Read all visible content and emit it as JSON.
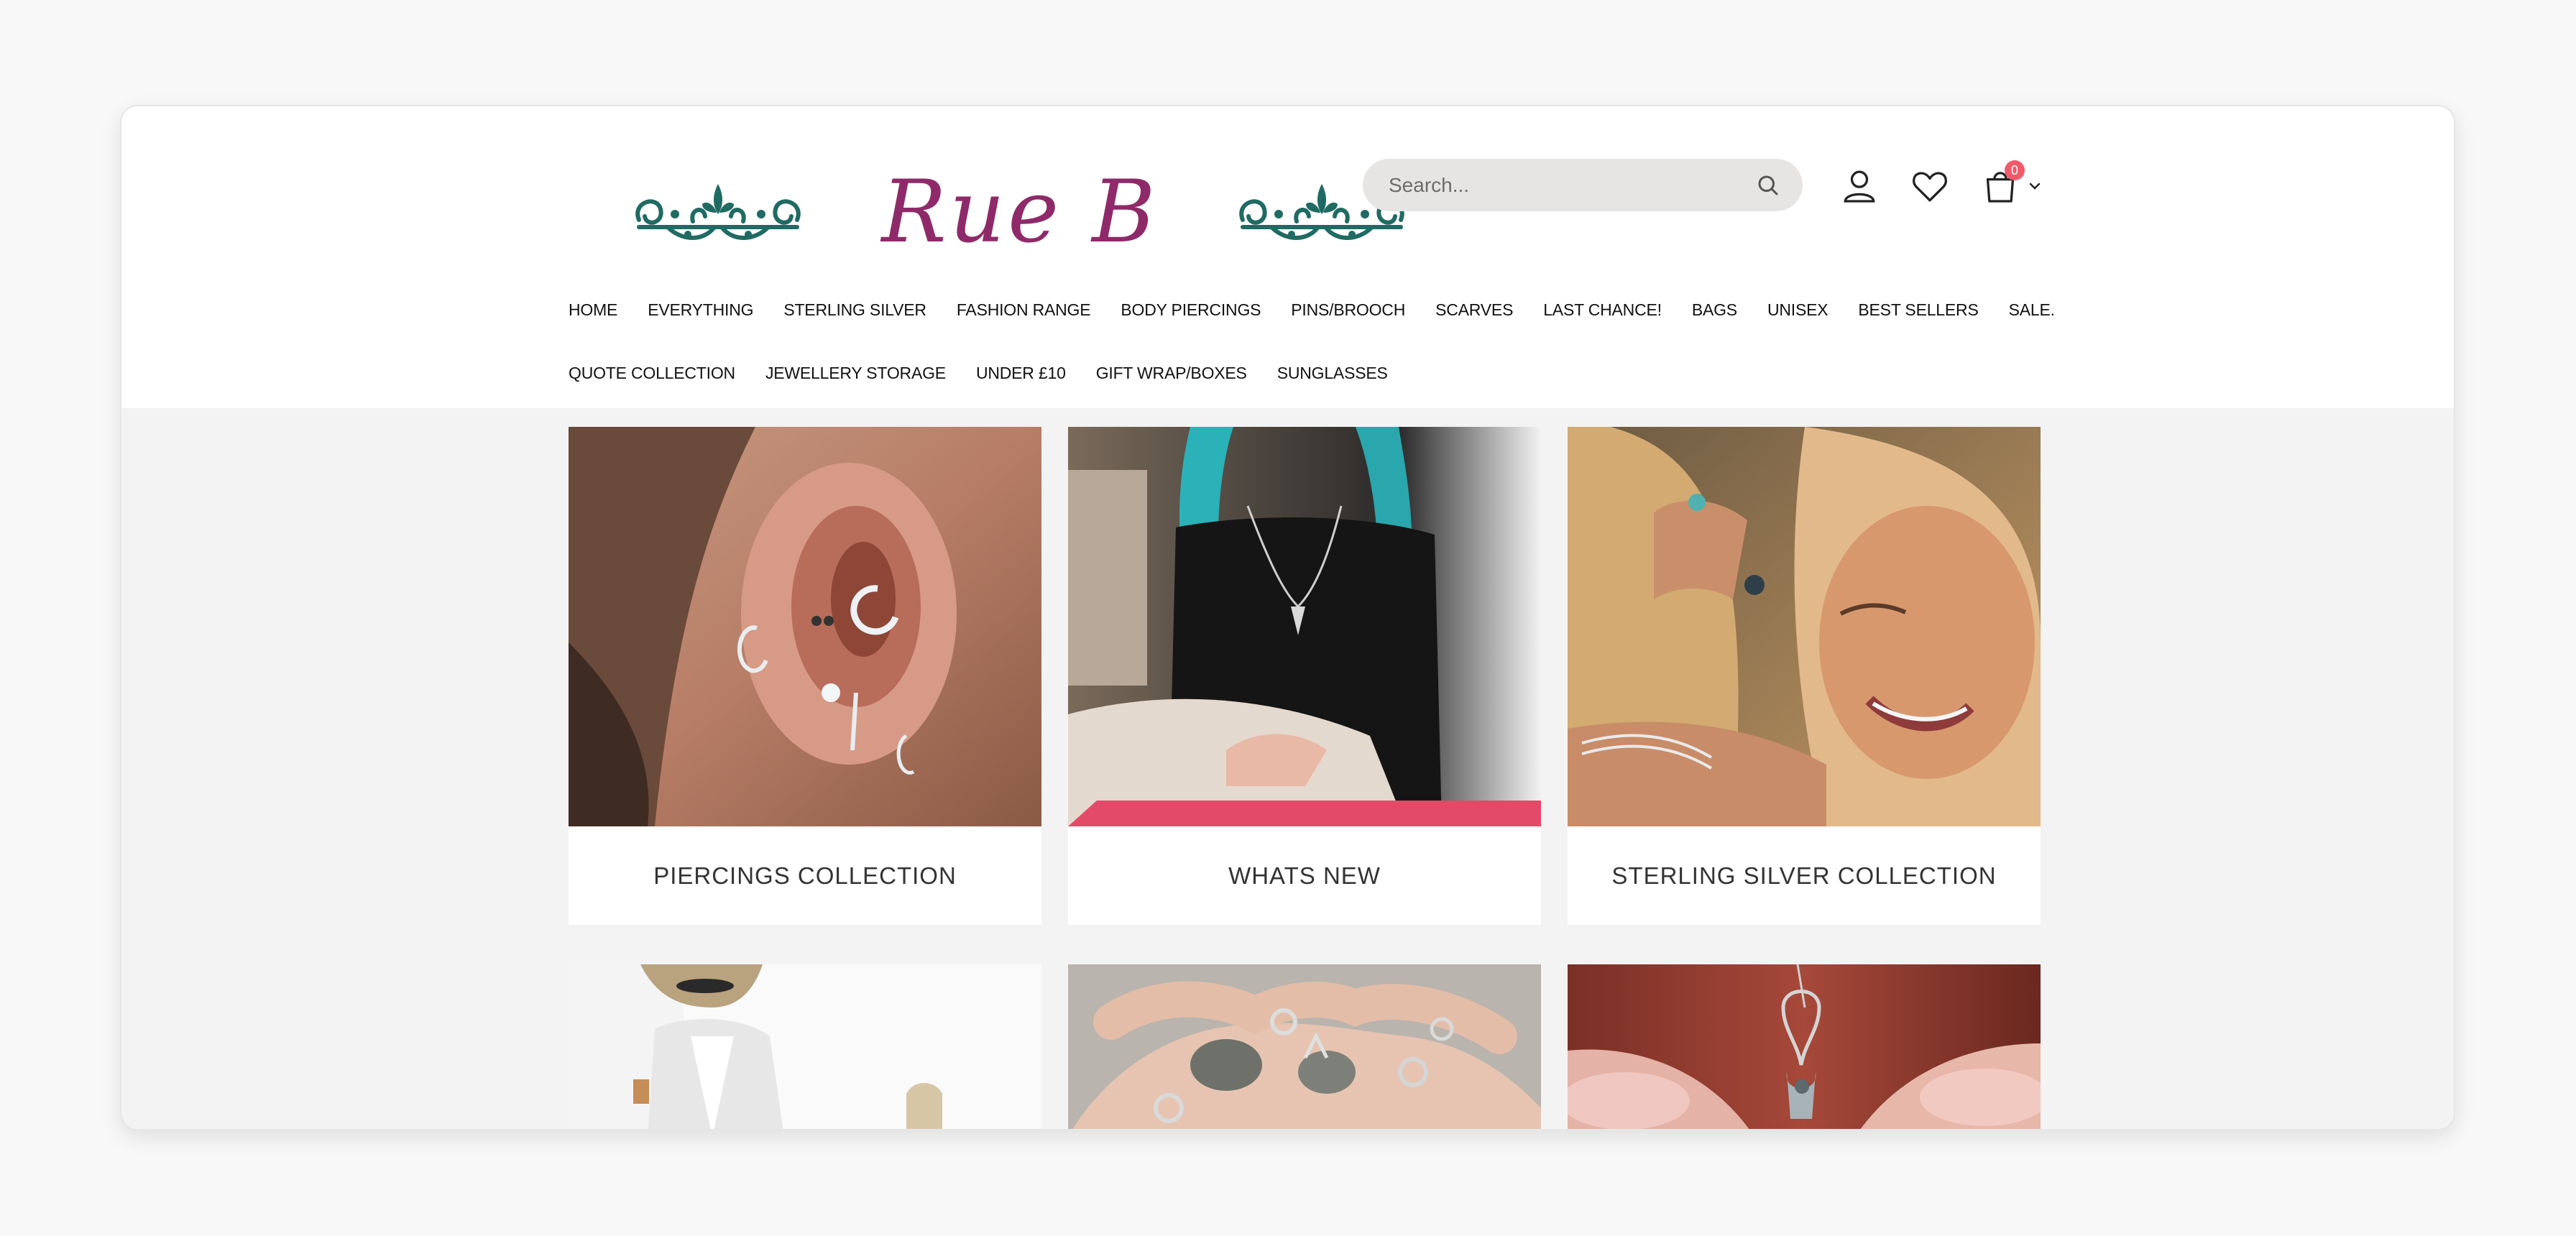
{
  "logo": {
    "text": "Rue B",
    "ornament_color": "#1f6b63",
    "text_color": "#8f2a6a"
  },
  "search": {
    "placeholder": "Search...",
    "icon": "search-icon"
  },
  "header_icons": {
    "account": "user-icon",
    "wishlist": "heart-icon",
    "cart": "shopping-bag-icon",
    "cart_count": "0",
    "cart_dropdown": "chevron-down-icon"
  },
  "nav": {
    "row1": [
      "HOME",
      "EVERYTHING",
      "STERLING SILVER",
      "FASHION RANGE",
      "BODY PIERCINGS",
      "PINS/BROOCH",
      "SCARVES",
      "LAST CHANCE!",
      "BAGS",
      "UNISEX",
      "BEST SELLERS",
      "SALE."
    ],
    "row2": [
      "QUOTE COLLECTION",
      "JEWELLERY STORAGE",
      "UNDER £10",
      "GIFT WRAP/BOXES",
      "SUNGLASSES"
    ]
  },
  "collections": [
    {
      "title": "PIERCINGS COLLECTION",
      "image": "ear-piercings-photo"
    },
    {
      "title": "WHATS NEW",
      "image": "necklace-photo"
    },
    {
      "title": "STERLING SILVER COLLECTION",
      "image": "woman-earring-photo"
    },
    {
      "title": "",
      "image": "fashion-woman-photo"
    },
    {
      "title": "",
      "image": "rings-hands-photo"
    },
    {
      "title": "",
      "image": "pendant-photo"
    }
  ],
  "colors": {
    "badge": "#f25a6b",
    "search_bg": "#e7e5e3",
    "page_bg": "#f3f3f3"
  }
}
